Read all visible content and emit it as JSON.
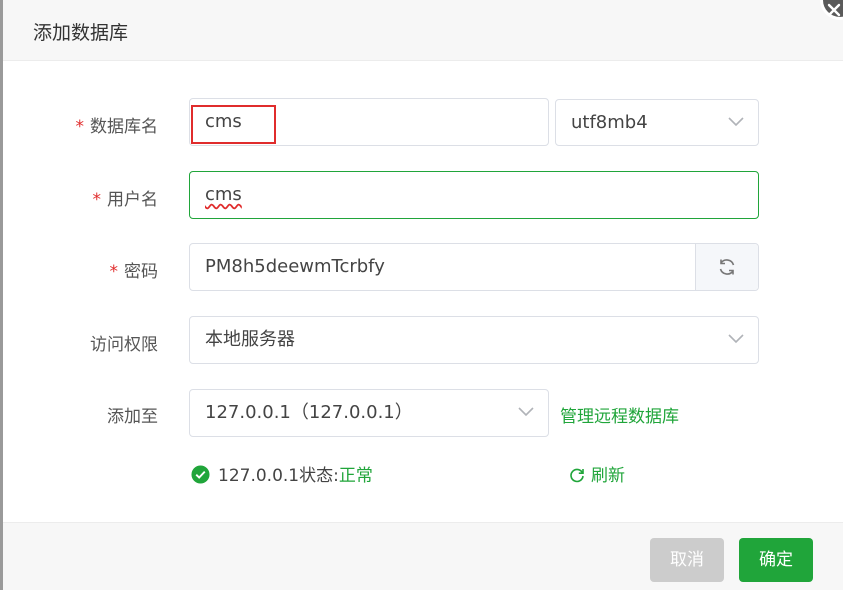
{
  "dialog": {
    "title": "添加数据库"
  },
  "form": {
    "db_name": {
      "label": "数据库名",
      "value": "cms",
      "required_mark": "*"
    },
    "charset": {
      "value": "utf8mb4"
    },
    "username": {
      "label": "用户名",
      "value": "cms",
      "required_mark": "*"
    },
    "password": {
      "label": "密码",
      "value": "PM8h5deewmTcrbfy",
      "required_mark": "*"
    },
    "access": {
      "label": "访问权限",
      "value": "本地服务器"
    },
    "add_to": {
      "label": "添加至",
      "value": "127.0.0.1（127.0.0.1）",
      "manage_link": "管理远程数据库"
    },
    "status": {
      "prefix": "127.0.0.1状态:",
      "value": "正常",
      "refresh": "刷新"
    }
  },
  "buttons": {
    "cancel": "取消",
    "confirm": "确定"
  },
  "colors": {
    "accent": "#20a53a",
    "required": "#e02c2c",
    "highlight_box": "#e02c2c"
  }
}
